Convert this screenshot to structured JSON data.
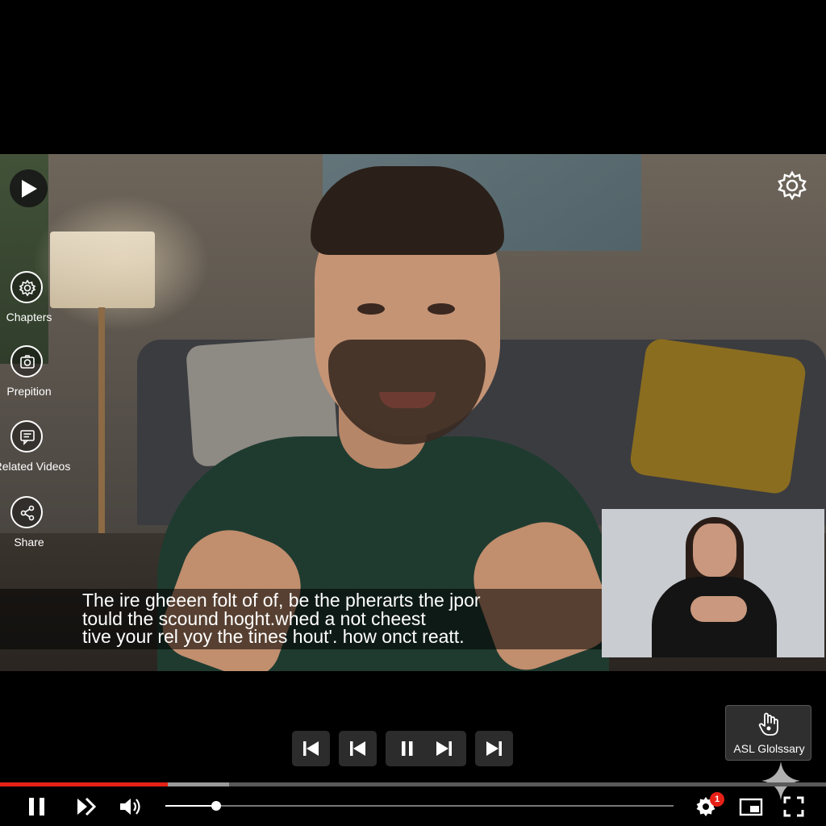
{
  "video": {
    "captions": [
      "The ire gheeen folt of of, be the pherarts the jpor",
      "tould the scound hoght.whed a not cheest",
      "tive your rel yoy the tines hout'. how onct reatt."
    ]
  },
  "side_menu": {
    "items": [
      {
        "label": "Chapters",
        "icon": "gear-icon"
      },
      {
        "label": "Prepition",
        "icon": "camera-icon"
      },
      {
        "label": "Related Videos",
        "icon": "chat-icon"
      },
      {
        "label": "Share",
        "icon": "share-icon"
      }
    ]
  },
  "asl_glossary": {
    "label": "ASL Glolssary",
    "icon": "hand-pointer-icon"
  },
  "transport": {
    "buttons": [
      "skip-back-icon",
      "previous-icon",
      "pause-icon",
      "next-icon",
      "skip-forward-icon"
    ]
  },
  "playback": {
    "progress_played": 0.203,
    "progress_buffered": 0.277,
    "volume": 0.1
  },
  "settings": {
    "notification_count": "1"
  },
  "colors": {
    "progress_played": "#e62117",
    "badge": "#e62117",
    "transport_bg": "#2c2c2c"
  }
}
